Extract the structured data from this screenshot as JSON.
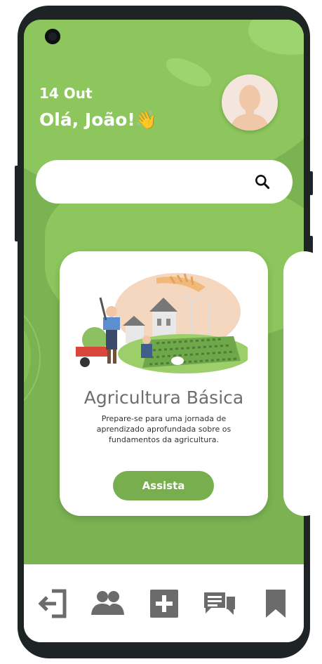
{
  "header": {
    "date": "14 Out",
    "greeting": "Olá, João!👋"
  },
  "search": {
    "placeholder": "",
    "value": ""
  },
  "card": {
    "title": "Agricultura Básica",
    "description": "Prepare-se para uma jornada de aprendizado aprofundada sobre os fundamentos da agricultura.",
    "button_label": "Assista"
  },
  "nav": {
    "items": [
      {
        "icon": "logout-icon"
      },
      {
        "icon": "users-icon"
      },
      {
        "icon": "add-icon"
      },
      {
        "icon": "chat-icon"
      },
      {
        "icon": "bookmark-icon"
      }
    ]
  },
  "colors": {
    "background_green": "#7bb352",
    "light_green": "#8dc85b",
    "button_green": "#79ae4e",
    "icon_gray": "#6b6b6b"
  }
}
